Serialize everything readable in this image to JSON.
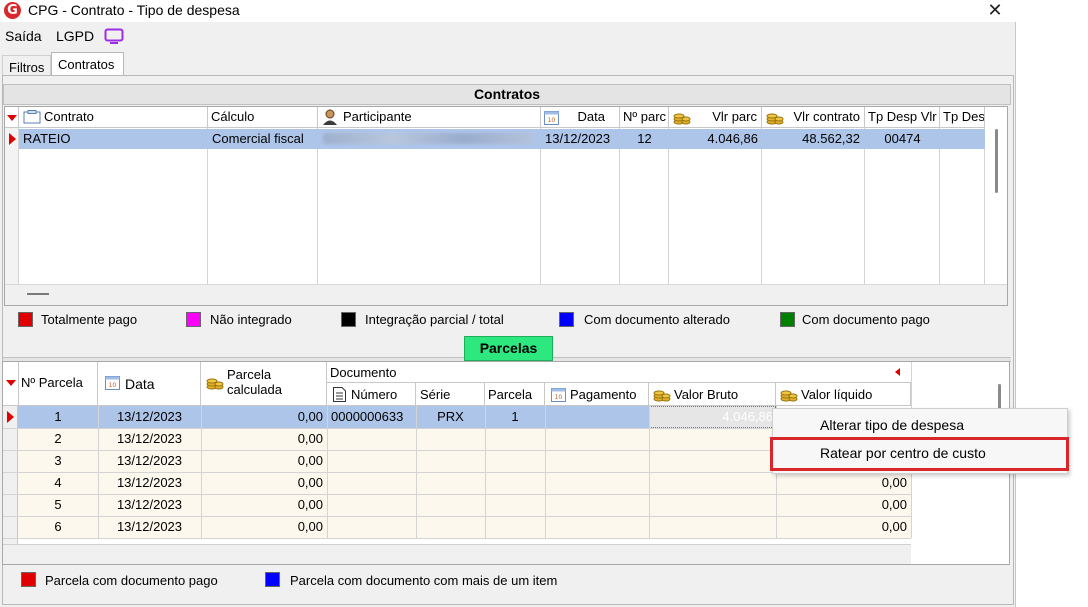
{
  "window": {
    "title": "CPG - Contrato - Tipo de despesa",
    "close_glyph": "✕",
    "logo_letter": "G"
  },
  "menu": {
    "saida": "Saída",
    "lgpd": "LGPD"
  },
  "tabs": [
    {
      "label": "Filtros",
      "active": false
    },
    {
      "label": "Contratos",
      "active": true
    }
  ],
  "contratos": {
    "section_title": "Contratos",
    "columns": [
      "Contrato",
      "Cálculo",
      "Participante",
      "Data",
      "Nº parc",
      "Vlr parc",
      "Vlr contrato",
      "Tp Desp Vlr",
      "Tp Des"
    ],
    "rows": [
      {
        "contrato": "RATEIO",
        "calculo": "Comercial fiscal",
        "participante": "",
        "data": "13/12/2023",
        "n_parc": "12",
        "vlr_parc": "4.046,86",
        "vlr_contrato": "48.562,32",
        "tp_desp_vlr": "00474",
        "tp_des": ""
      }
    ],
    "legend": [
      {
        "label": "Totalmente pago",
        "color": "#e00000"
      },
      {
        "label": "Não integrado",
        "color": "#ff00ff"
      },
      {
        "label": "Integração parcial / total",
        "color": "#000000"
      },
      {
        "label": "Com documento alterado",
        "color": "#0000ff"
      },
      {
        "label": "Com documento pago",
        "color": "#008000"
      }
    ]
  },
  "parcelas": {
    "section_title": "Parcelas",
    "columns": {
      "n_parcela": "Nº Parcela",
      "data": "Data",
      "parcela_calculada": "Parcela calculada",
      "documento_group": "Documento",
      "numero": "Número",
      "serie": "Série",
      "parcela": "Parcela",
      "pagamento": "Pagamento",
      "valor_bruto": "Valor Bruto",
      "valor_liquido": "Valor líquido"
    },
    "rows": [
      {
        "n": "1",
        "data": "13/12/2023",
        "calc": "0,00",
        "numero": "0000000633",
        "serie": "PRX",
        "parcela": "1",
        "pagamento": "",
        "valor_bruto": "4.046,86",
        "valor_liquido": ""
      },
      {
        "n": "2",
        "data": "13/12/2023",
        "calc": "0,00",
        "numero": "",
        "serie": "",
        "parcela": "",
        "pagamento": "",
        "valor_bruto": "",
        "valor_liquido": ""
      },
      {
        "n": "3",
        "data": "13/12/2023",
        "calc": "0,00",
        "numero": "",
        "serie": "",
        "parcela": "",
        "pagamento": "",
        "valor_bruto": "",
        "valor_liquido": ""
      },
      {
        "n": "4",
        "data": "13/12/2023",
        "calc": "0,00",
        "numero": "",
        "serie": "",
        "parcela": "",
        "pagamento": "",
        "valor_bruto": "",
        "valor_liquido": "0,00"
      },
      {
        "n": "5",
        "data": "13/12/2023",
        "calc": "0,00",
        "numero": "",
        "serie": "",
        "parcela": "",
        "pagamento": "",
        "valor_bruto": "",
        "valor_liquido": "0,00"
      },
      {
        "n": "6",
        "data": "13/12/2023",
        "calc": "0,00",
        "numero": "",
        "serie": "",
        "parcela": "",
        "pagamento": "",
        "valor_bruto": "",
        "valor_liquido": "0,00"
      }
    ],
    "legend": [
      {
        "label": "Parcela com documento pago",
        "color": "#e00000"
      },
      {
        "label": "Parcela com documento com mais de um item",
        "color": "#0000ff"
      }
    ]
  },
  "context_menu": {
    "items": [
      {
        "label": "Alterar tipo de despesa",
        "highlighted": false
      },
      {
        "label": "Ratear por centro de custo",
        "highlighted": true
      }
    ],
    "highlight_color": "#d8262b"
  },
  "icons": {
    "contract": "contract-icon",
    "participant": "person-icon",
    "calendar": "calendar-icon",
    "coins": "coins-icon",
    "document": "document-icon",
    "monitor": "monitor-icon"
  }
}
